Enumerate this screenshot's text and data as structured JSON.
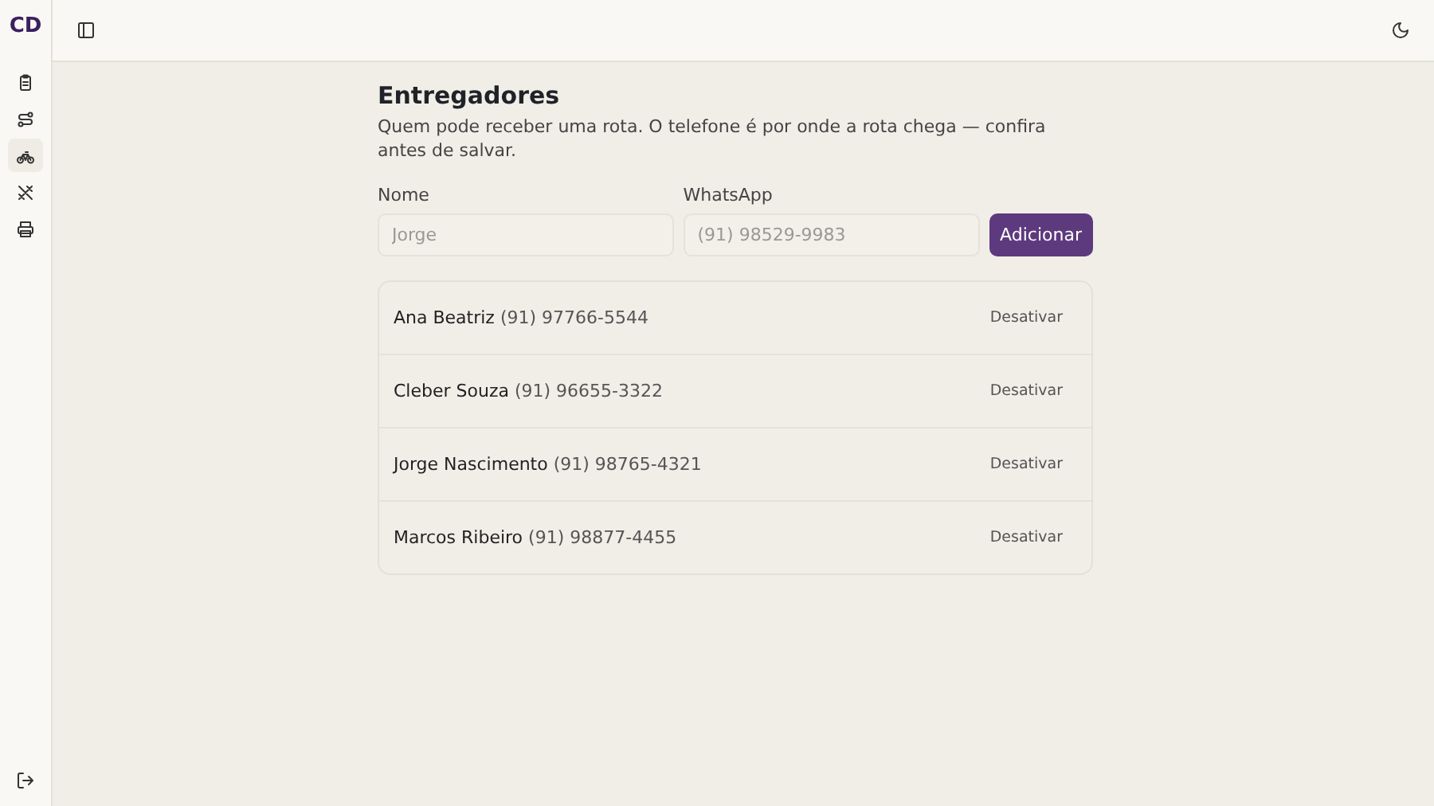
{
  "sidebar": {
    "logo": "CD",
    "items": [
      {
        "selected": false
      },
      {
        "selected": false
      },
      {
        "selected": true
      },
      {
        "selected": false
      },
      {
        "selected": false
      }
    ]
  },
  "page": {
    "title": "Entregadores",
    "description": "Quem pode receber uma rota. O telefone é por onde a rota chega — confira antes de salvar."
  },
  "form": {
    "fields": [
      {
        "label": "Nome",
        "placeholder": "Jorge"
      },
      {
        "label": "WhatsApp",
        "placeholder": "(91) 98529-9983"
      }
    ],
    "button": "Adicionar"
  },
  "couriers": [
    {
      "name": "Ana Beatriz",
      "phone": "(91) 97766-5544",
      "action": "Desativar"
    },
    {
      "name": "Cleber Souza",
      "phone": "(91) 96655-3322",
      "action": "Desativar"
    },
    {
      "name": "Jorge Nascimento",
      "phone": "(91) 98765-4321",
      "action": "Desativar"
    },
    {
      "name": "Marcos Ribeiro",
      "phone": "(91) 98877-4455",
      "action": "Desativar"
    }
  ]
}
